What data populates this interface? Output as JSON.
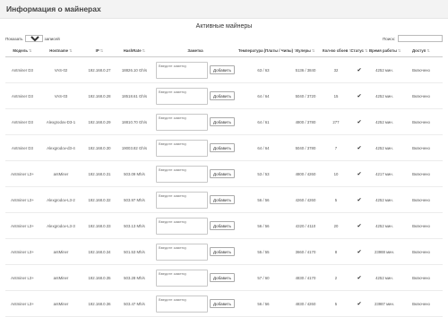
{
  "page": {
    "title": "Информация о майнерах"
  },
  "table_title": "Активные майнеры",
  "controls": {
    "show_label": "Показать",
    "show_value": "10",
    "records_label": "записей",
    "search_label": "Поиск:"
  },
  "columns": [
    "Модель",
    "Hostname",
    "IP",
    "HashRate",
    "Заметка",
    "Температура (Платы / Чипы)",
    "Кулеры",
    "Кол-во сбоев",
    "Статус",
    "Время работы",
    "Доступ"
  ],
  "note_placeholder": "Введите заметку",
  "add_label": "Добавить",
  "rows": [
    {
      "model": "Antminer D3",
      "hostname": "VAS-02",
      "ip": "192.168.0.27",
      "hashrate": "18826.10 Gh/s",
      "temp": "63 / 63",
      "fans": "5136 / 3840",
      "failures": "32",
      "status": "✔",
      "uptime": "4252 мин.",
      "access": "Включено"
    },
    {
      "model": "Antminer D3",
      "hostname": "VAS-03",
      "ip": "192.168.0.28",
      "hashrate": "18518.61 Gh/s",
      "temp": "64 / 64",
      "fans": "5040 / 3720",
      "failures": "15",
      "status": "✔",
      "uptime": "4252 мин.",
      "access": "Включено"
    },
    {
      "model": "Antminer D3",
      "hostname": "Alexgrodov-D3-1",
      "ip": "192.168.0.29",
      "hashrate": "18810.70 Gh/s",
      "temp": "64 / 61",
      "fans": "4800 / 3780",
      "failures": "277",
      "status": "✔",
      "uptime": "4252 мин.",
      "access": "Включено"
    },
    {
      "model": "Antminer D3",
      "hostname": "Alexgrodov-d3-4",
      "ip": "192.168.0.30",
      "hashrate": "19003.82 Gh/s",
      "temp": "64 / 64",
      "fans": "5040 / 3780",
      "failures": "7",
      "status": "✔",
      "uptime": "4252 мин.",
      "access": "Включено"
    },
    {
      "model": "Antminer L3+",
      "hostname": "antMiner",
      "ip": "192.168.0.31",
      "hashrate": "503.09 Mh/s",
      "temp": "53 / 53",
      "fans": "4800 / 4260",
      "failures": "10",
      "status": "✔",
      "uptime": "4217 мин.",
      "access": "Включено"
    },
    {
      "model": "Antminer L3+",
      "hostname": "Alexgrodov-L3-2",
      "ip": "192.168.0.32",
      "hashrate": "503.97 Mh/s",
      "temp": "56 / 56",
      "fans": "4260 / 4260",
      "failures": "5",
      "status": "✔",
      "uptime": "4252 мин.",
      "access": "Включено"
    },
    {
      "model": "Antminer L3+",
      "hostname": "Alexgrodov-L3-3",
      "ip": "192.168.0.33",
      "hashrate": "503.13 Mh/s",
      "temp": "56 / 56",
      "fans": "4320 / 4110",
      "failures": "20",
      "status": "✔",
      "uptime": "4252 мин.",
      "access": "Включено"
    },
    {
      "model": "Antminer L3+",
      "hostname": "antMiner",
      "ip": "192.168.0.34",
      "hashrate": "501.53 Mh/s",
      "temp": "55 / 55",
      "fans": "3660 / 4170",
      "failures": "8",
      "status": "✔",
      "uptime": "23988 мин.",
      "access": "Включено"
    },
    {
      "model": "Antminer L3+",
      "hostname": "antMiner",
      "ip": "192.168.0.35",
      "hashrate": "503.28 Mh/s",
      "temp": "57 / 60",
      "fans": "4830 / 4170",
      "failures": "2",
      "status": "✔",
      "uptime": "4252 мин.",
      "access": "Включено"
    },
    {
      "model": "Antminer L3+",
      "hostname": "antMiner",
      "ip": "192.168.0.36",
      "hashrate": "503.47 Mh/s",
      "temp": "56 / 56",
      "fans": "4830 / 4260",
      "failures": "5",
      "status": "✔",
      "uptime": "23987 мин.",
      "access": "Включено"
    }
  ]
}
